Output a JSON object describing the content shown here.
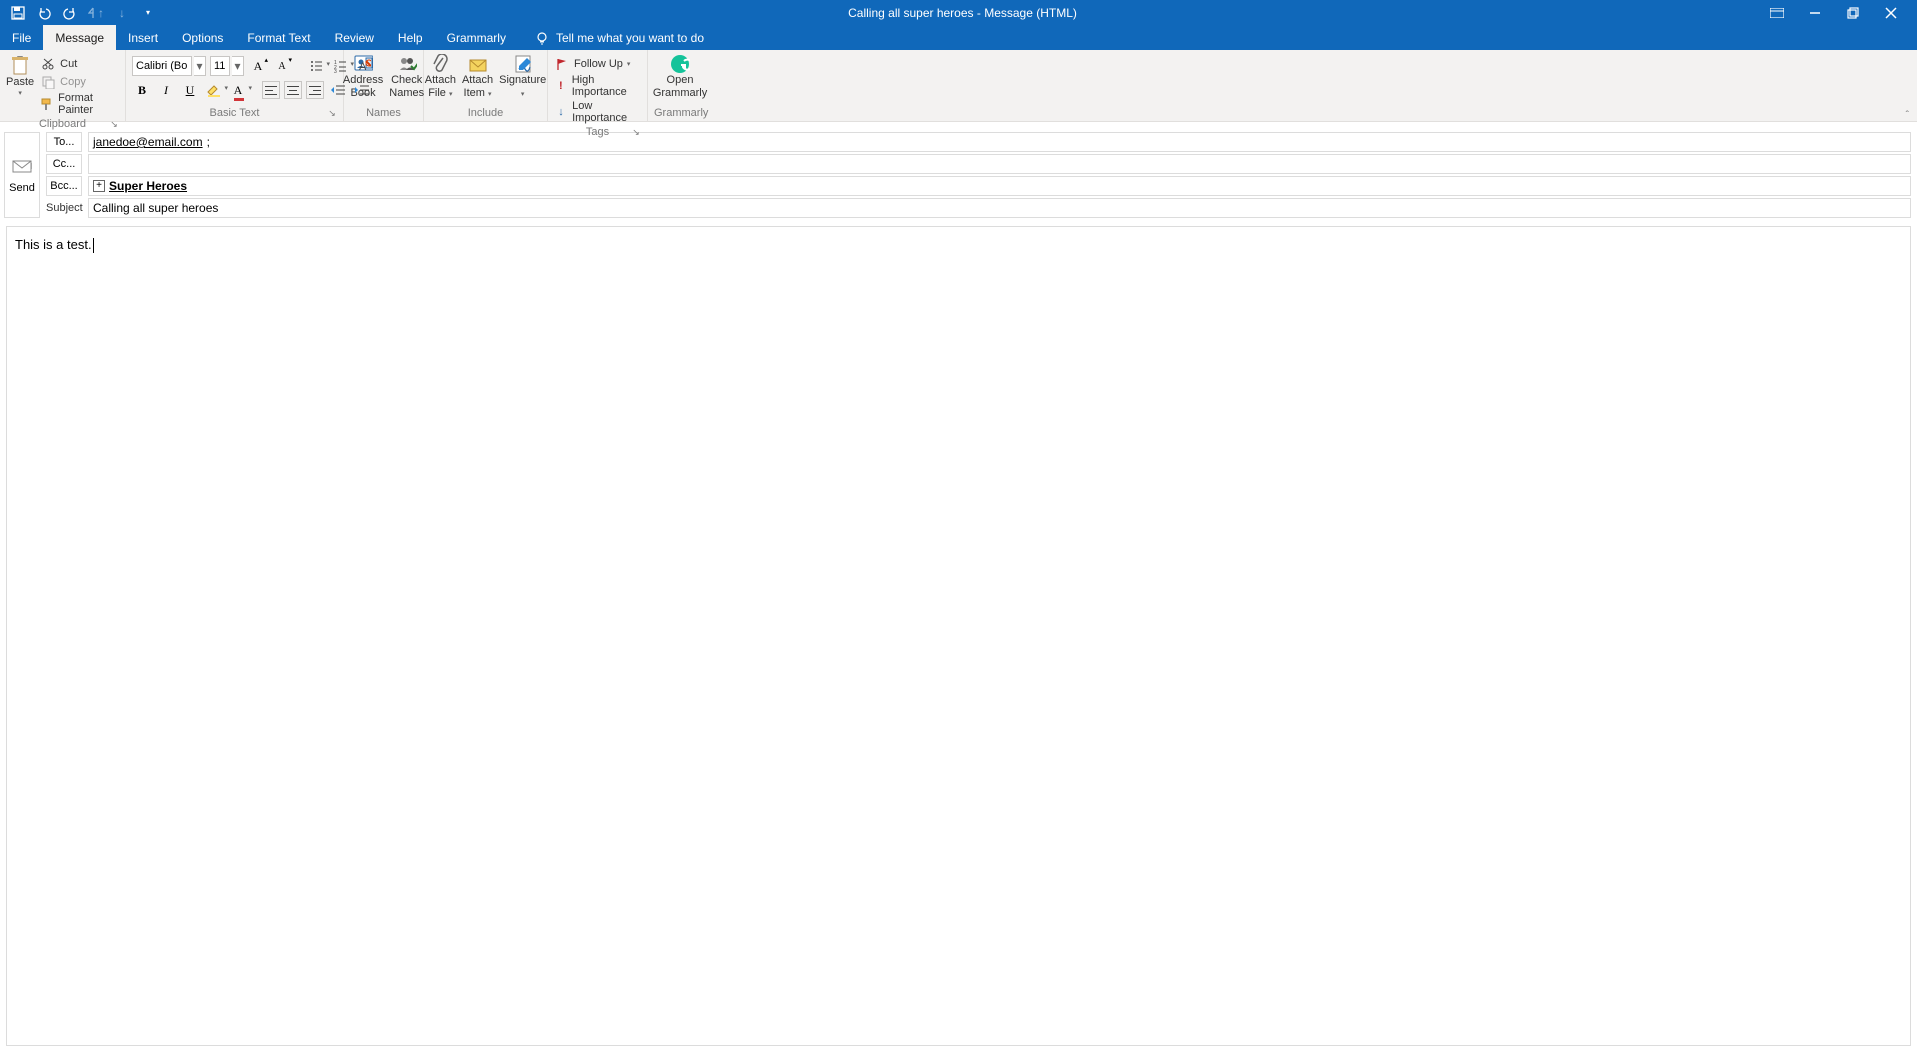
{
  "window_title": "Calling all super heroes  -  Message (HTML)",
  "tabs": [
    "File",
    "Message",
    "Insert",
    "Options",
    "Format Text",
    "Review",
    "Help",
    "Grammarly"
  ],
  "active_tab": "Message",
  "tell_me": "Tell me what you want to do",
  "clipboard": {
    "paste": "Paste",
    "cut": "Cut",
    "copy": "Copy",
    "painter": "Format Painter",
    "group": "Clipboard"
  },
  "basic_text": {
    "font_name": "Calibri (Bo",
    "font_size": "11",
    "group": "Basic Text"
  },
  "names": {
    "address_book": "Address Book",
    "check_names": "Check Names",
    "group": "Names"
  },
  "include": {
    "attach_file": "Attach File",
    "attach_item": "Attach Item",
    "signature": "Signature",
    "group": "Include"
  },
  "tags": {
    "follow_up": "Follow Up",
    "high": "High Importance",
    "low": "Low Importance",
    "group": "Tags"
  },
  "grammarly": {
    "open": "Open Grammarly",
    "group": "Grammarly"
  },
  "addr": {
    "send": "Send",
    "to_label": "To...",
    "cc_label": "Cc...",
    "bcc_label": "Bcc...",
    "subject_label": "Subject",
    "to_value": "janedoe@email.com",
    "to_suffix": ";",
    "cc_value": "",
    "bcc_value": "Super Heroes",
    "subject_value": "Calling all super heroes"
  },
  "body_text": "This is a test."
}
